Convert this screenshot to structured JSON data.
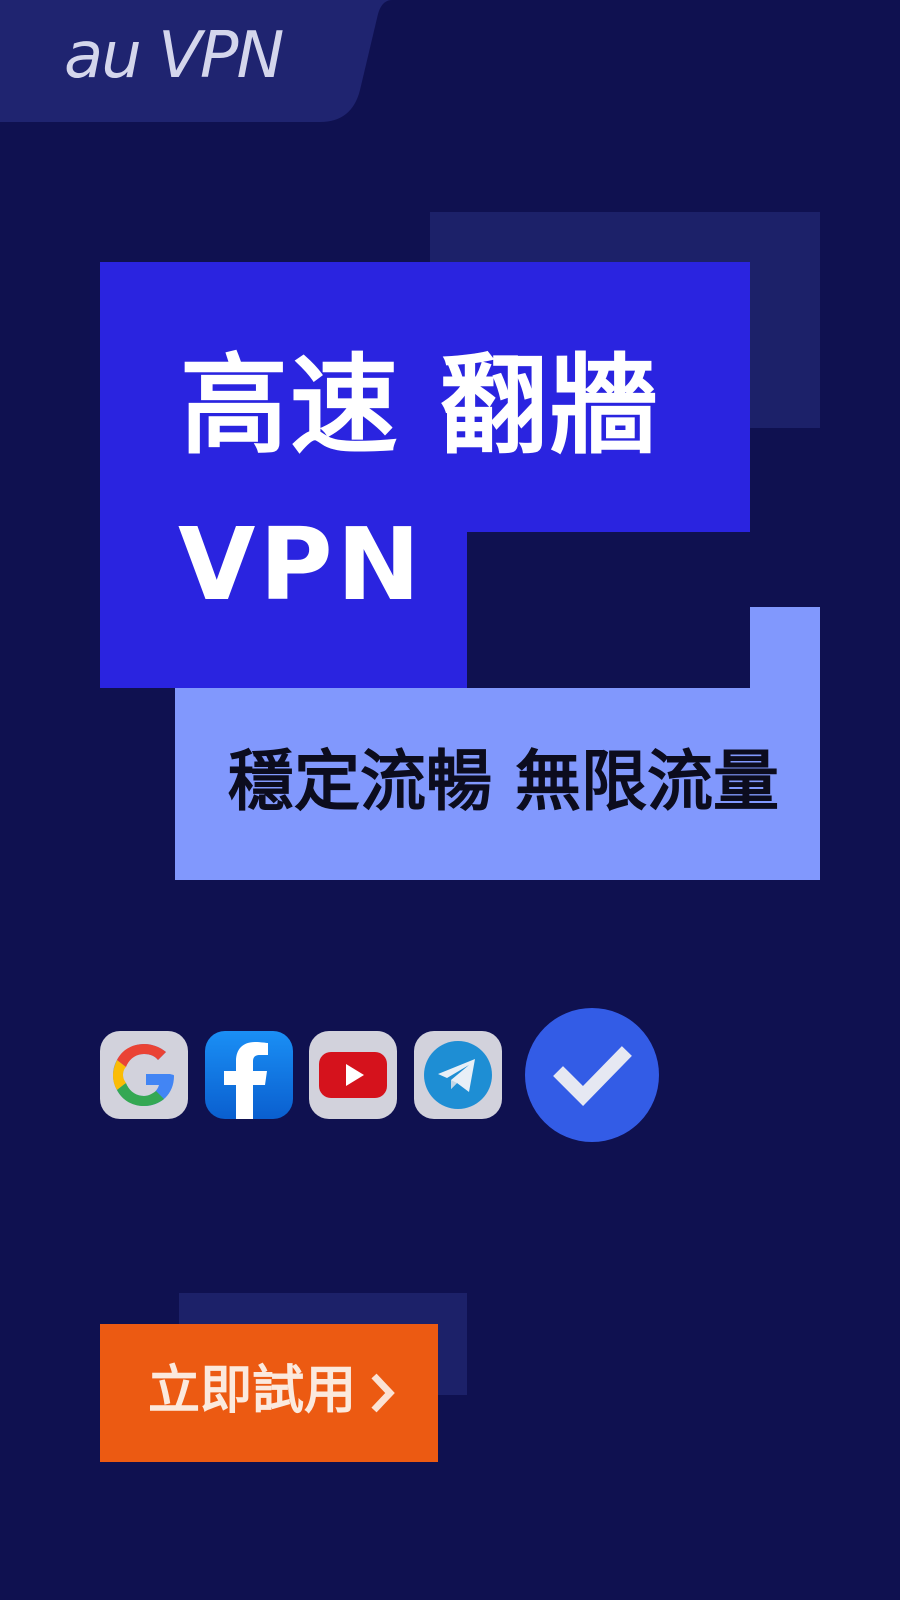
{
  "brand": {
    "logo_text": "au VPN"
  },
  "headline": {
    "line1": "高速 翻牆",
    "line2": "VPN"
  },
  "subtitle": "穩定流暢 無限流量",
  "apps": [
    {
      "name": "google",
      "icon": "google-icon"
    },
    {
      "name": "facebook",
      "icon": "facebook-icon"
    },
    {
      "name": "youtube",
      "icon": "youtube-icon"
    },
    {
      "name": "telegram",
      "icon": "telegram-icon"
    }
  ],
  "status_icon": "checkmark-icon",
  "cta": {
    "label": "立即試用",
    "icon": "chevron-right-icon"
  },
  "colors": {
    "background": "#0f1150",
    "headline_block": "#2a24e0",
    "subtitle_block": "#8198fd",
    "accent_block": "#1c2169",
    "cta": "#ec5a12",
    "check": "#335ce6"
  }
}
